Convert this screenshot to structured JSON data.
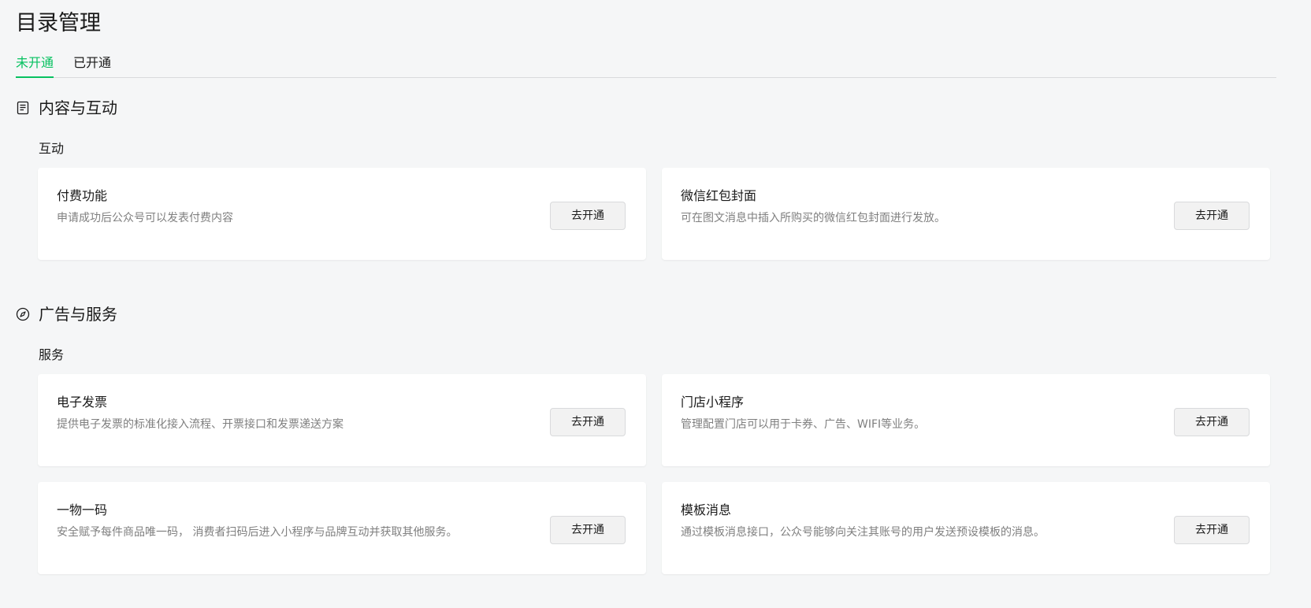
{
  "page": {
    "title": "目录管理"
  },
  "tabs": [
    {
      "label": "未开通",
      "active": true
    },
    {
      "label": "已开通",
      "active": false
    }
  ],
  "sections": [
    {
      "label": "内容与互动",
      "icon": "document-icon",
      "groups": [
        {
          "title": "互动",
          "cards": [
            {
              "name": "付费功能",
              "desc": "申请成功后公众号可以发表付费内容",
              "button": "去开通"
            },
            {
              "name": "微信红包封面",
              "desc": "可在图文消息中插入所购买的微信红包封面进行发放。",
              "button": "去开通"
            }
          ]
        }
      ]
    },
    {
      "label": "广告与服务",
      "icon": "compass-icon",
      "groups": [
        {
          "title": "服务",
          "cards": [
            {
              "name": "电子发票",
              "desc": "提供电子发票的标准化接入流程、开票接口和发票递送方案",
              "button": "去开通"
            },
            {
              "name": "门店小程序",
              "desc": "管理配置门店可以用于卡券、广告、WIFI等业务。",
              "button": "去开通"
            },
            {
              "name": "一物一码",
              "desc": "安全赋予每件商品唯一码， 消费者扫码后进入小程序与品牌互动并获取其他服务。",
              "button": "去开通"
            },
            {
              "name": "模板消息",
              "desc": "通过模板消息接口，公众号能够向关注其账号的用户发送预设模板的消息。",
              "button": "去开通"
            }
          ]
        }
      ]
    }
  ],
  "colors": {
    "accent": "#07c160",
    "background": "#f5f6f7",
    "card": "#ffffff",
    "text_secondary": "#7f7f7f"
  }
}
